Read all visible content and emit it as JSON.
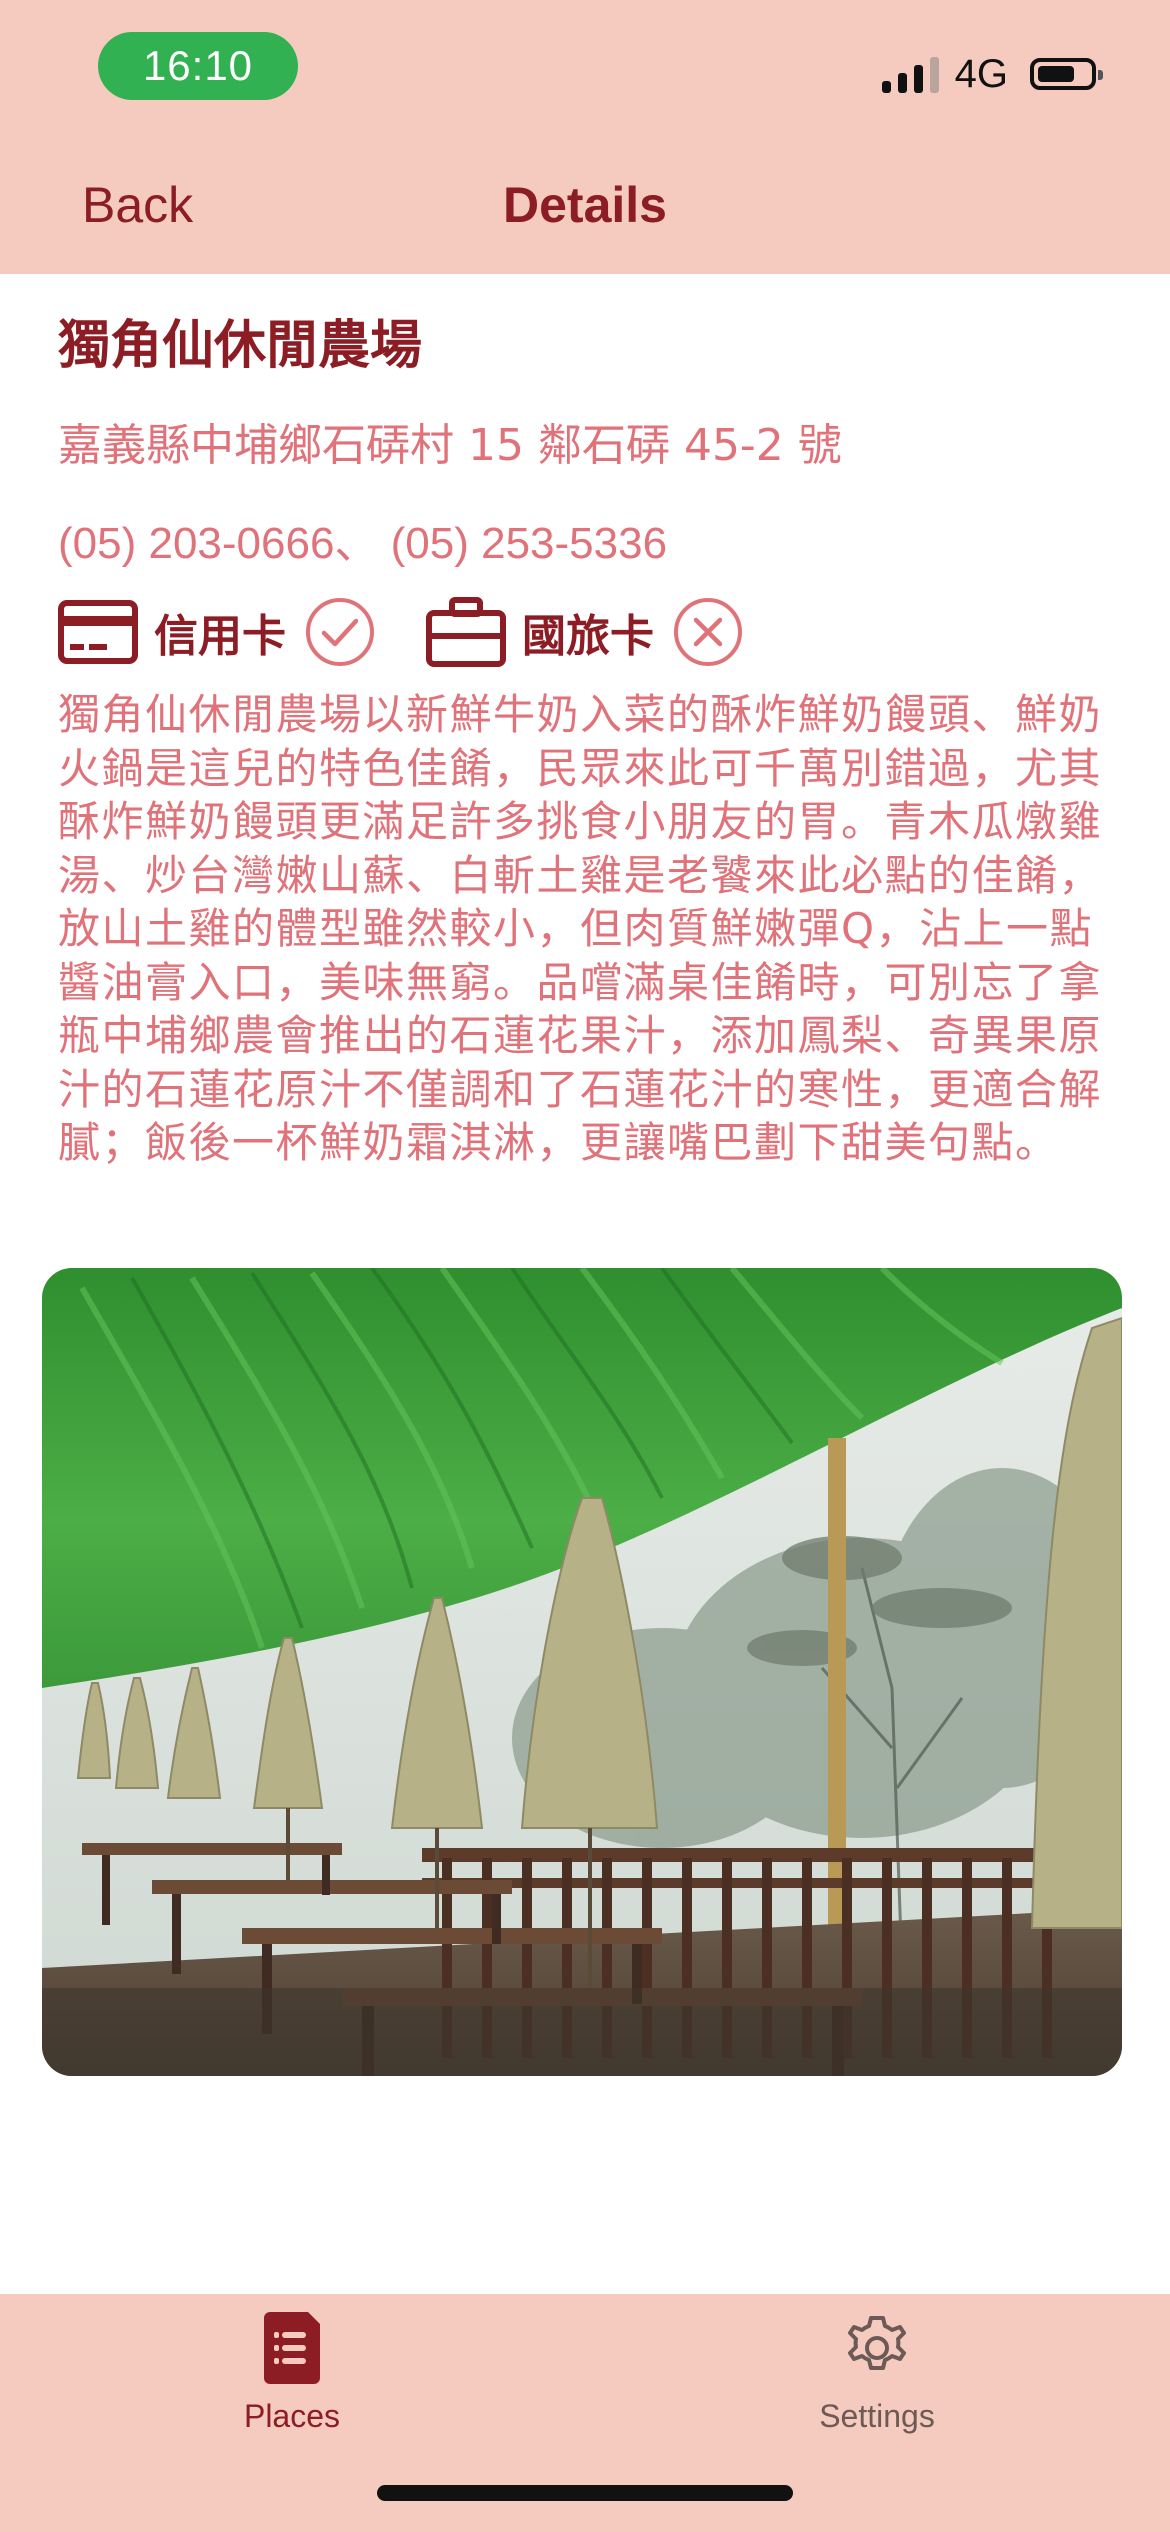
{
  "status_bar": {
    "time": "16:10",
    "network": "4G"
  },
  "nav": {
    "back_label": "Back",
    "title": "Details"
  },
  "place": {
    "name": "獨角仙休閒農場",
    "address": "嘉義縣中埔鄉石硦村 15 鄰石硦 45-2 號",
    "phone": "(05) 203-0666、 (05) 253-5336",
    "payments": [
      {
        "label": "信用卡",
        "accepted": true,
        "icon": "credit-card-icon"
      },
      {
        "label": "國旅卡",
        "accepted": false,
        "icon": "briefcase-icon"
      }
    ],
    "description": "獨角仙休閒農場以新鮮牛奶入菜的酥炸鮮奶饅頭、鮮奶火鍋是這兒的特色佳餚，民眾來此可千萬別錯過，尤其酥炸鮮奶饅頭更滿足許多挑食小朋友的胃。青木瓜燉雞湯、炒台灣嫩山蘇、白斬土雞是老饕來此必點的佳餚，放山土雞的體型雖然較小，但肉質鮮嫩彈Q，沾上一點醬油膏入口，美味無窮。品嚐滿桌佳餚時，可別忘了拿瓶中埔鄉農會推出的石蓮花果汁，添加鳳梨、奇異果原汁的石蓮花原汁不僅調和了石蓮花汁的寒性，更適合解膩；飯後一杯鮮奶霜淇淋，更讓嘴巴劃下甜美句點。"
  },
  "tabs": [
    {
      "label": "Places",
      "icon": "document-list-icon",
      "active": true
    },
    {
      "label": "Settings",
      "icon": "gear-icon",
      "active": false
    }
  ],
  "colors": {
    "accent": "#8c1d24",
    "text_pink": "#e0727a",
    "bar_bg": "#f6cbbf",
    "status_green": "#31b151"
  }
}
